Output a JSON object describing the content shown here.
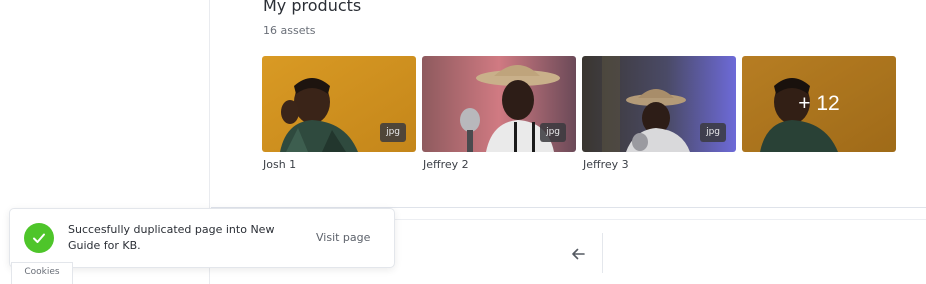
{
  "products": {
    "title": "My products",
    "count": "16 assets",
    "items": [
      {
        "label": "Josh 1",
        "badge": "jpg"
      },
      {
        "label": "Jeffrey 2",
        "badge": "jpg"
      },
      {
        "label": "Jeffrey 3",
        "badge": "jpg"
      }
    ],
    "more_label": "+ 12"
  },
  "toast": {
    "message": "Succesfully duplicated page into New Guide for KB.",
    "action": "Visit page",
    "icon": "check-icon",
    "color": "#4ec52a"
  },
  "footer": {
    "cookies_label": "Cookies",
    "back_icon": "arrow-left-icon"
  }
}
